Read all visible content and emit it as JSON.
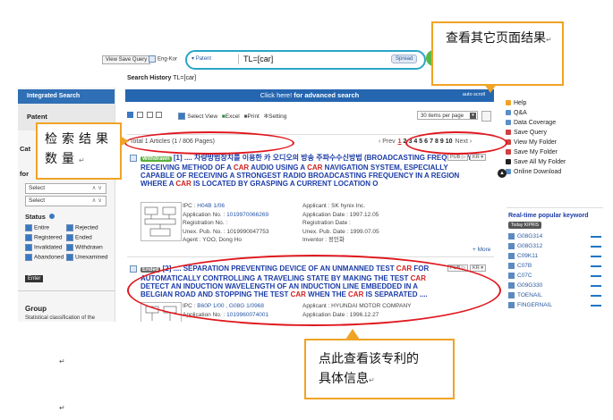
{
  "top": {
    "view_save_query": "View Save Query",
    "eng_kor": "Eng-Kor",
    "patent_dropdown": "Patent",
    "query": "TL=[car]",
    "spread": "Spread",
    "history_label": "Search History",
    "history_value": "TL=[car]"
  },
  "sidebar": {
    "tab_integrated": "Integrated Search",
    "patent_section": "Patent",
    "cut_cat": "Cat",
    "cut_for": "for",
    "select1": "Select",
    "select2": "Select",
    "status_title": "Status",
    "statuses": [
      {
        "label": "Entire",
        "checked": true
      },
      {
        "label": "Rejected",
        "checked": true
      },
      {
        "label": "Registered",
        "checked": true
      },
      {
        "label": "Ended",
        "checked": true
      },
      {
        "label": "Invalidated",
        "checked": true
      },
      {
        "label": "Withdrawn",
        "checked": true
      },
      {
        "label": "Abandoned",
        "checked": true
      },
      {
        "label": "Unexamined",
        "checked": true
      }
    ],
    "enter": "Enter",
    "group_title": "Group",
    "group_desc": "Statistical classification of the"
  },
  "main": {
    "banner_text": "Click here!",
    "banner_bold": "for advanced search",
    "autoscroll": "auto scroll",
    "toolbar_select": "Select View",
    "toolbar_excel": "Excel",
    "toolbar_print": "Print",
    "toolbar_setting": "Setting",
    "items_per_page": "30 items per page",
    "total_text": "Total 1  Articles (1 / 806 Pages)",
    "prev": "‹ Prev",
    "pages": [
      "1",
      "2",
      "3",
      "4",
      "5",
      "6",
      "7",
      "8",
      "9",
      "10"
    ],
    "next": "Next ›",
    "results": [
      {
        "badge": "Withdrawn",
        "number": "[1]",
        "korean": ".... 차량방범장치를 이용한 카 오디오의 방송 주파수수신방법",
        "title_parts": [
          "(BROADCASTING FREQUENCY RECEIVING METHOD OF A ",
          "CAR",
          " AUDIO USING A ",
          "CAR",
          " NAVIGATION SYSTEM, ESPECIALLY CAPABLE OF RECEIVING A STRONGEST RADIO BROADCASTING FREQUENCY IN A REGION WHERE A ",
          "CAR",
          " IS LOCATED BY GRASPING A CURRENT LOCATION O"
        ],
        "pub": "PUB",
        "kr": "KR",
        "ipc_label": "IPC : ",
        "ipc": "H04B 1/06",
        "app_no_label": "Application No. : ",
        "app_no": "1019970066269",
        "reg_no_label": "Registration No. :",
        "reg_no": "",
        "unex_label": "Unex. Pub. No. : ",
        "unex": "1019990047753",
        "agent_label": "Agent : ",
        "agent": "YOO, Dong Ho",
        "applicant_label": "Applicant : ",
        "applicant": "SK hynix Inc.",
        "app_date_label": "Application Date : ",
        "app_date": "1997.12.05",
        "reg_date_label": "Registration Date :",
        "reg_date": "",
        "unex_date_label": "Unex. Pub. Date : ",
        "unex_date": "1999.07.05",
        "inventor_label": "Inventor : ",
        "inventor": "정인화",
        "more": "+ More"
      },
      {
        "badge": "Ended",
        "number": "[2]",
        "title_parts": [
          ".... SEPARATION PREVENTING DEVICE OF AN UNMANNED TEST ",
          "CAR",
          " FOR AUTOMATICALLY CONTROLLING A TRAVELING STATE BY MAKING THE TEST ",
          "CAR",
          " DETECT AN INDUCTION WAVELENGTH OF AN INDUCTION LINE EMBEDDED IN A BELGIAN ROAD AND STOPPING THE TEST ",
          "CAR",
          " WHEN THE ",
          "CAR",
          " IS SEPARATED ...."
        ],
        "pub": "PUB",
        "kr": "KR",
        "ipc_label": "IPC : ",
        "ipc": "B60P 1/00 , G08G 1/0968",
        "app_no_label": "Application No. : ",
        "app_no": "1019960074001",
        "applicant_label": "Applicant : ",
        "applicant": "HYUNDAI MOTOR COMPANY",
        "app_date_label": "Application Date : ",
        "app_date": "1996.12.27"
      }
    ]
  },
  "right": {
    "links": [
      {
        "label": "Help",
        "color": "#f0a325"
      },
      {
        "label": "Q&A",
        "color": "#5a8fc7"
      },
      {
        "label": "Data Coverage",
        "color": "#5a8fc7"
      },
      {
        "label": "Save Query",
        "color": "#d04040"
      },
      {
        "label": "View My Folder",
        "color": "#d04040"
      },
      {
        "label": "Save My Folder",
        "color": "#d04040"
      },
      {
        "label": "Save All My Folder",
        "color": "#222222"
      },
      {
        "label": "Online Download",
        "color": "#5a8fc7"
      }
    ],
    "keyword_title": "Real-time popular keyword",
    "today_badge": "Today KIPRIS",
    "keywords": [
      "G08G314",
      "G08G312",
      "C09K11",
      "C07B",
      "C07C",
      "G09G330",
      "TOENAIL",
      "FINGERNAIL"
    ]
  },
  "callouts": {
    "other_pages": "查看其它页面结果",
    "count": "检索结果数量",
    "detail_line1": "点此查看该专利的",
    "detail_line2": "具体信息",
    "para": "↵"
  }
}
